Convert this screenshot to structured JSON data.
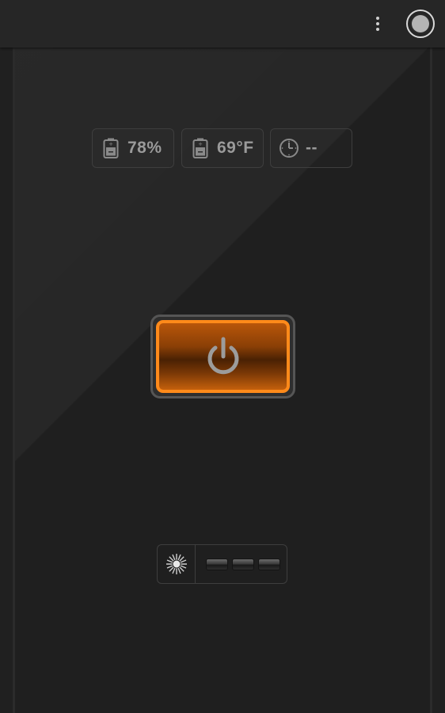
{
  "topbar": {
    "overflow_icon": "more-vert-icon",
    "record_icon": "record-circle-icon"
  },
  "stats": [
    {
      "icon": "battery-icon",
      "value": "78%"
    },
    {
      "icon": "battery-icon",
      "value": "69°F"
    },
    {
      "icon": "clock-icon",
      "value": "--"
    }
  ],
  "power_button": {
    "icon": "power-icon",
    "accent": "#ff8a1a"
  },
  "mode_selector": {
    "icon": "strobe-sun-icon",
    "bars": 3
  },
  "colors": {
    "background": "#1f1f1f",
    "accent": "#ff8a1a",
    "text": "#9a9a9a"
  }
}
